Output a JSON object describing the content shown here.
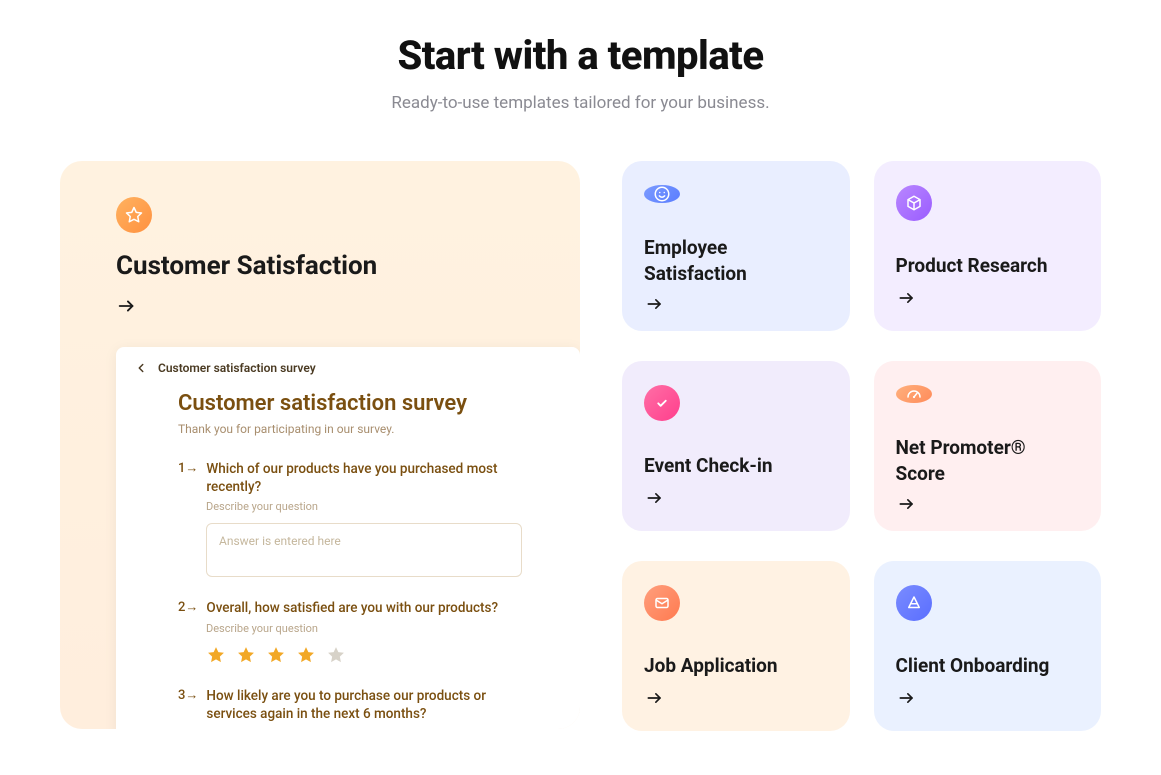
{
  "heading": "Start with a template",
  "subheading": "Ready-to-use templates tailored for your business.",
  "feature": {
    "title": "Customer Satisfaction",
    "icon": "star-outline-icon"
  },
  "preview": {
    "back_label": "Customer satisfaction survey",
    "title": "Customer satisfaction survey",
    "intro": "Thank you for participating in our survey.",
    "q1": {
      "num": "1→",
      "text": "Which of our products have you purchased most recently?",
      "desc": "Describe your question",
      "placeholder": "Answer is entered here"
    },
    "q2": {
      "num": "2→",
      "text": "Overall,  how satisfied are you with our products?",
      "desc": "Describe your question",
      "rating_filled": 4,
      "rating_total": 5
    },
    "q3": {
      "num": "3→",
      "text": "How likely are you to purchase our products or services again in the next 6 months?"
    }
  },
  "cards": [
    {
      "title": "Employee Satisfaction",
      "bg": "bg-lav",
      "badge": "blue",
      "icon": "smile-icon"
    },
    {
      "title": "Product Research",
      "bg": "bg-lilac",
      "badge": "purple",
      "icon": "cube-icon"
    },
    {
      "title": "Event Check-in",
      "bg": "bg-lav2",
      "badge": "pink",
      "icon": "check-icon"
    },
    {
      "title": "Net Promoter® Score",
      "bg": "bg-rose",
      "badge": "peach",
      "icon": "gauge-icon"
    },
    {
      "title": "Job Application",
      "bg": "bg-cream",
      "badge": "coral",
      "icon": "mail-icon"
    },
    {
      "title": "Client Onboarding",
      "bg": "bg-sky",
      "badge": "indigo",
      "icon": "pyramid-icon"
    }
  ]
}
